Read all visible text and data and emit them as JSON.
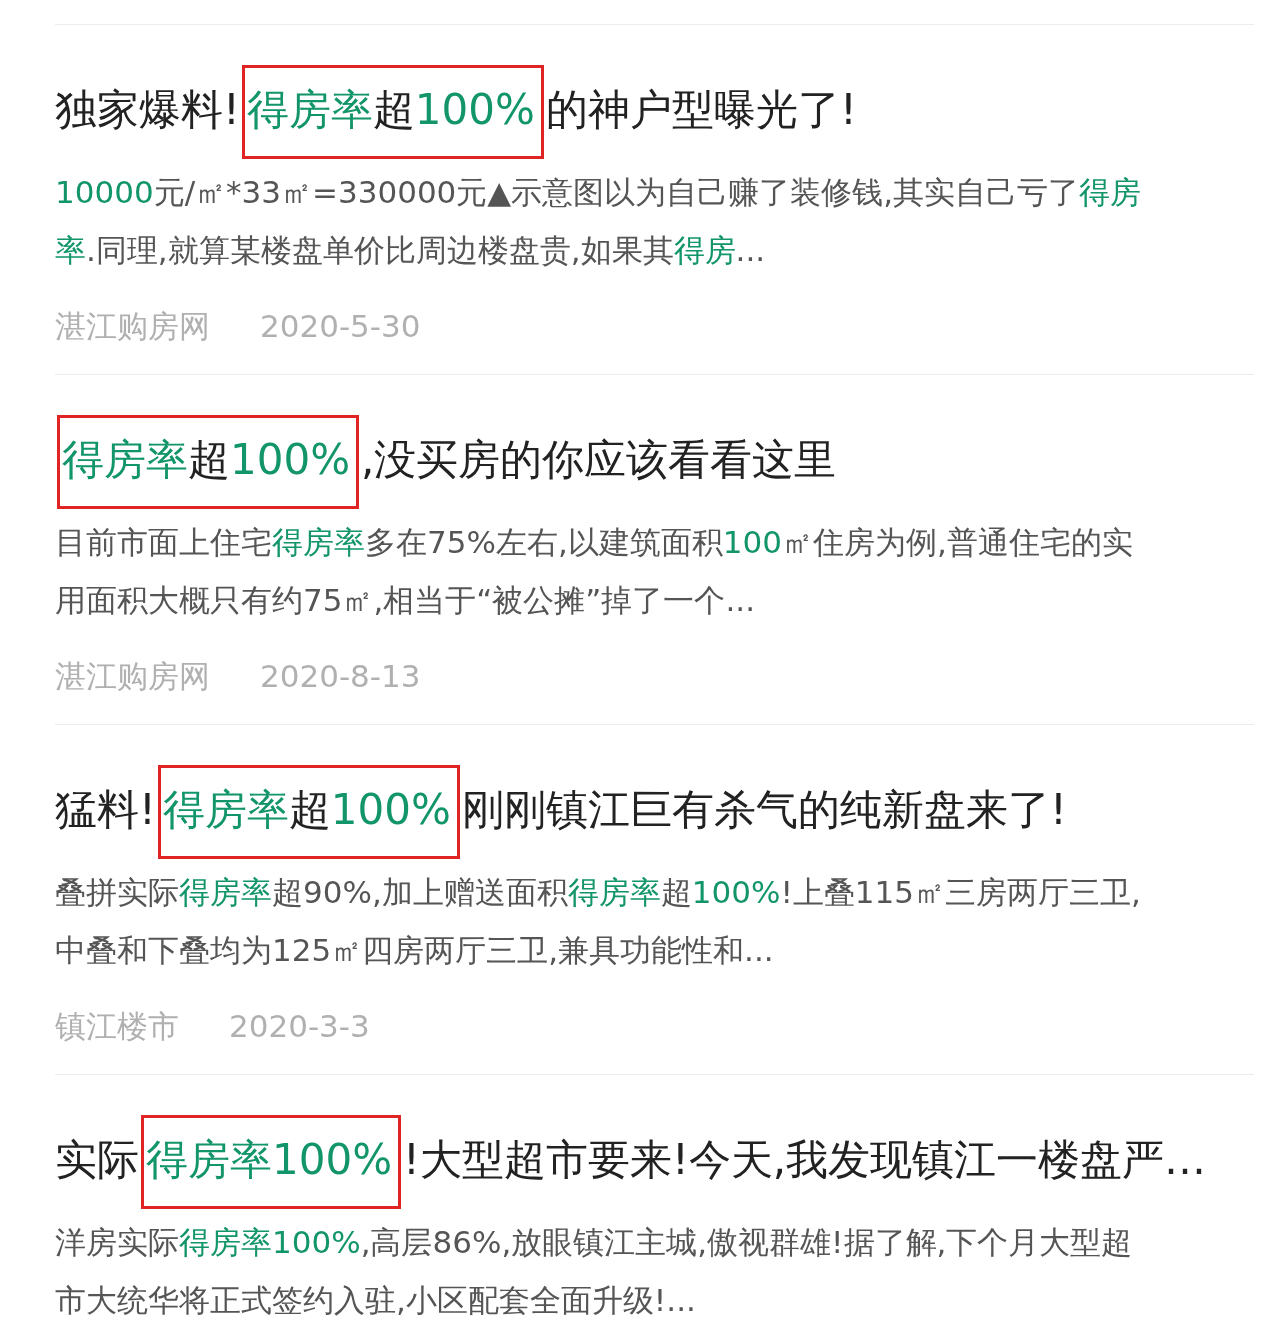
{
  "results": [
    {
      "title": [
        {
          "text": "独家爆料!",
          "highlight": false,
          "boxed": false
        },
        {
          "text": "得房率",
          "highlight": true,
          "boxed": true
        },
        {
          "text": "超",
          "highlight": false,
          "boxed": true
        },
        {
          "text": "100%",
          "highlight": true,
          "boxed": true
        },
        {
          "text": "的神户型曝光了!",
          "highlight": false,
          "boxed": false
        }
      ],
      "snippet_lines": [
        [
          {
            "text": "10000",
            "highlight": true
          },
          {
            "text": "元/㎡*33㎡=330000元▲示意图以为自己赚了装修钱,其实自己亏了",
            "highlight": false
          },
          {
            "text": "得房",
            "highlight": true
          }
        ],
        [
          {
            "text": "率",
            "highlight": true
          },
          {
            "text": ".同理,就算某楼盘单价比周边楼盘贵,如果其",
            "highlight": false
          },
          {
            "text": "得房",
            "highlight": true
          },
          {
            "text": "...",
            "highlight": false
          }
        ]
      ],
      "source": "湛江购房网",
      "date": "2020-5-30"
    },
    {
      "title": [
        {
          "text": "得房率",
          "highlight": true,
          "boxed": true
        },
        {
          "text": "超",
          "highlight": false,
          "boxed": true
        },
        {
          "text": "100%",
          "highlight": true,
          "boxed": true
        },
        {
          "text": ",没买房的你应该看看这里",
          "highlight": false,
          "boxed": false
        }
      ],
      "snippet_lines": [
        [
          {
            "text": "目前市面上住宅",
            "highlight": false
          },
          {
            "text": "得房率",
            "highlight": true
          },
          {
            "text": "多在75%左右,以建筑面积",
            "highlight": false
          },
          {
            "text": "100",
            "highlight": true
          },
          {
            "text": "㎡住房为例,普通住宅的实",
            "highlight": false
          }
        ],
        [
          {
            "text": "用面积大概只有约75㎡,相当于“被公摊”掉了一个...",
            "highlight": false
          }
        ]
      ],
      "source": "湛江购房网",
      "date": "2020-8-13"
    },
    {
      "title": [
        {
          "text": "猛料!",
          "highlight": false,
          "boxed": false
        },
        {
          "text": "得房率",
          "highlight": true,
          "boxed": true
        },
        {
          "text": "超",
          "highlight": false,
          "boxed": true
        },
        {
          "text": "100%",
          "highlight": true,
          "boxed": true
        },
        {
          "text": "刚刚镇江巨有杀气的纯新盘来了!",
          "highlight": false,
          "boxed": false
        }
      ],
      "snippet_lines": [
        [
          {
            "text": "叠拼实际",
            "highlight": false
          },
          {
            "text": "得房率",
            "highlight": true
          },
          {
            "text": "超90%,加上赠送面积",
            "highlight": false
          },
          {
            "text": "得房率",
            "highlight": true
          },
          {
            "text": "超",
            "highlight": false
          },
          {
            "text": "100%",
            "highlight": true
          },
          {
            "text": "!上叠115㎡三房两厅三卫,",
            "highlight": false
          }
        ],
        [
          {
            "text": "中叠和下叠均为125㎡四房两厅三卫,兼具功能性和...",
            "highlight": false
          }
        ]
      ],
      "source": "镇江楼市",
      "date": "2020-3-3"
    },
    {
      "title": [
        {
          "text": "实际",
          "highlight": false,
          "boxed": false
        },
        {
          "text": "得房率",
          "highlight": true,
          "boxed": true
        },
        {
          "text": "100%",
          "highlight": true,
          "boxed": true
        },
        {
          "text": "!大型超市要来!今天,我发现镇江一楼盘严…",
          "highlight": false,
          "boxed": false
        }
      ],
      "snippet_lines": [
        [
          {
            "text": "洋房实际",
            "highlight": false
          },
          {
            "text": "得房率",
            "highlight": true
          },
          {
            "text": "100%",
            "highlight": true
          },
          {
            "text": ",高层86%,放眼镇江主城,傲视群雄!据了解,下个月大型超",
            "highlight": false
          }
        ],
        [
          {
            "text": "市大统华将正式签约入驻,小区配套全面升级!...",
            "highlight": false
          }
        ]
      ]
    }
  ]
}
